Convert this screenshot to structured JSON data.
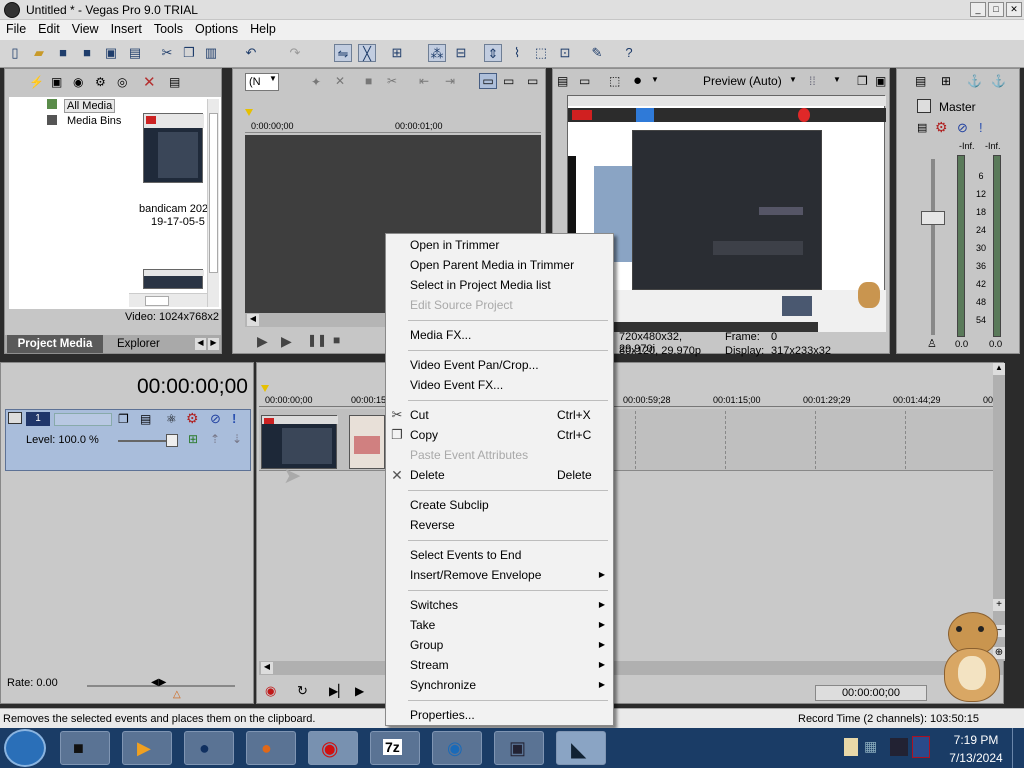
{
  "window": {
    "title": "Untitled * - Vegas Pro 9.0 TRIAL",
    "min": "_",
    "max": "□",
    "close": "✕"
  },
  "menu": [
    "File",
    "Edit",
    "View",
    "Insert",
    "Tools",
    "Options",
    "Help"
  ],
  "media": {
    "tree": [
      "All Media",
      "Media Bins"
    ],
    "clip_name": "bandicam 202",
    "clip_time": "19-17-05-5",
    "video_info": "Video: 1024x768x2",
    "tabs": [
      "Project Media",
      "Explorer"
    ]
  },
  "trimmer": {
    "combo": "(N",
    "ruler": [
      "0:00:00;00",
      "00:00:01;00"
    ]
  },
  "preview": {
    "quality": "Preview (Auto)",
    "info1": "720x480x32, 29.970i",
    "info2": "80x120, 29.970p",
    "frame_label": "Frame:",
    "frame_value": "0",
    "display_label": "Display:",
    "display_value": "317x233x32"
  },
  "master": {
    "title": "Master",
    "inf_left": "-Inf.",
    "inf_right": "-Inf.",
    "scale": [
      "6",
      "12",
      "18",
      "24",
      "30",
      "36",
      "42",
      "48",
      "54"
    ],
    "val_left": "0.0",
    "val_right": "0.0"
  },
  "timeline": {
    "timecode": "00:00:00;00",
    "track_number": "1",
    "level": "Level: 100.0 %",
    "ruler": [
      "00:00:00;00",
      "00:00:15",
      "00:00:59;28",
      "00:01:15;00",
      "00:01:29;29",
      "00:01:44;29",
      "00:"
    ],
    "rate": "Rate: 0.00",
    "end_timecode": "00:00:00;00"
  },
  "status": {
    "left": "Removes the selected events and places them on the clipboard.",
    "right": "Record Time (2 channels): 103:50:15"
  },
  "context_menu": {
    "open_trimmer": "Open in Trimmer",
    "open_parent": "Open Parent Media in Trimmer",
    "select_in_list": "Select in Project Media list",
    "edit_source": "Edit Source Project",
    "media_fx": "Media FX...",
    "pan_crop": "Video Event Pan/Crop...",
    "event_fx": "Video Event FX...",
    "cut": "Cut",
    "cut_sc": "Ctrl+X",
    "copy": "Copy",
    "copy_sc": "Ctrl+C",
    "paste_attr": "Paste Event Attributes",
    "delete": "Delete",
    "delete_sc": "Delete",
    "subclip": "Create Subclip",
    "reverse": "Reverse",
    "select_to_end": "Select Events to End",
    "envelope": "Insert/Remove Envelope",
    "switches": "Switches",
    "take": "Take",
    "group": "Group",
    "stream": "Stream",
    "synchronize": "Synchronize",
    "properties": "Properties..."
  },
  "clock": {
    "time": "7:19 PM",
    "date": "7/13/2024"
  },
  "colors": {
    "track_header": "#a9bddb",
    "menu_bg": "#f2f2f2",
    "taskbar": "#1a3c66"
  }
}
